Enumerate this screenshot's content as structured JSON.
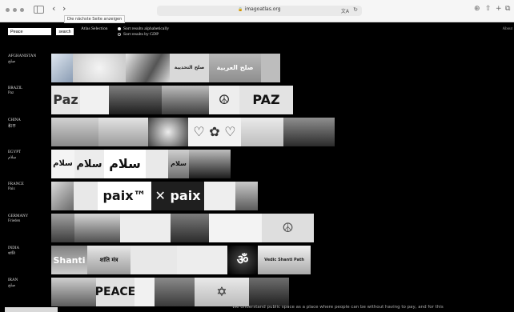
{
  "browser": {
    "url": "imagoatlas.org",
    "tooltip": "Die nächste Seite anzeigen",
    "back": "‹",
    "forward": "›",
    "reload": "↻",
    "translate": "文A",
    "icons": [
      "download-icon",
      "share-icon",
      "new-tab-icon",
      "tabs-icon"
    ]
  },
  "header": {
    "search_value": "Peace",
    "search_button": "search",
    "atlas_selection": "Atlas Selection",
    "sort_alpha": "Sort results alphabetically",
    "sort_gdp": "Sort results by GDP",
    "about": "About"
  },
  "countries": [
    {
      "name": "AFGHANISTAN",
      "native": "صلح",
      "images": [
        {
          "w": 27,
          "bg": "linear-gradient(135deg,#dfe7f0,#8a9cb3)",
          "caption": "",
          "color": "#333"
        },
        {
          "w": 66,
          "bg": "radial-gradient(circle,#f4f4f4,#c9c9c9)",
          "caption": "",
          "color": "#333"
        },
        {
          "w": 55,
          "bg": "linear-gradient(120deg,#e8e8e8,#555 60%,#ddd)",
          "caption": "",
          "color": "#222"
        },
        {
          "w": 49,
          "bg": "#d9d9d9",
          "caption": "صلح التحديية",
          "color": "#222"
        },
        {
          "w": 65,
          "bg": "linear-gradient(#b9b9b9,#8d8d8d)",
          "caption": "صلح العربية",
          "color": "#fff"
        },
        {
          "w": 24,
          "bg": "#bdbdbd",
          "caption": "",
          "color": "#222"
        }
      ]
    },
    {
      "name": "BRAZIL",
      "native": "Paz",
      "images": [
        {
          "w": 36,
          "bg": "#e6e6e6",
          "caption": "Paz",
          "color": "#333"
        },
        {
          "w": 36,
          "bg": "#f1f1f1",
          "caption": "",
          "color": "#222"
        },
        {
          "w": 66,
          "bg": "linear-gradient(#7e7e7e,#1e1e1e)",
          "caption": "",
          "color": "#fff"
        },
        {
          "w": 59,
          "bg": "linear-gradient(#bdbdbd,#3e3e3e)",
          "caption": "",
          "color": "#fff"
        },
        {
          "w": 38,
          "bg": "#ededed",
          "caption": "☮",
          "color": "#222"
        },
        {
          "w": 67,
          "bg": "#e3e3e3",
          "caption": "PAZ",
          "color": "#111"
        }
      ]
    },
    {
      "name": "CHINA",
      "native": "和平",
      "images": [
        {
          "w": 59,
          "bg": "linear-gradient(#d2d2d2,#8a8a8a)",
          "caption": "",
          "color": "#222"
        },
        {
          "w": 62,
          "bg": "linear-gradient(#e3e3e3,#9b9b9b)",
          "caption": "",
          "color": "#222"
        },
        {
          "w": 50,
          "bg": "radial-gradient(circle,#ededed,#404040)",
          "caption": "",
          "color": "#222"
        },
        {
          "w": 66,
          "bg": "#f2f2f2",
          "caption": "♡ ✿ ♡",
          "color": "#333"
        },
        {
          "w": 53,
          "bg": "linear-gradient(#eaeaea,#bdbdbd)",
          "caption": "",
          "color": "#222"
        },
        {
          "w": 64,
          "bg": "linear-gradient(#8f8f8f,#2b2b2b)",
          "caption": "",
          "color": "#fff"
        }
      ]
    },
    {
      "name": "EGYPT",
      "native": "سلام",
      "images": [
        {
          "w": 29,
          "bg": "#f4f4f4",
          "caption": "سلام",
          "color": "#111"
        },
        {
          "w": 37,
          "bg": "#ececec",
          "caption": "سلام",
          "color": "#111"
        },
        {
          "w": 52,
          "bg": "#ffffff",
          "caption": "سلام",
          "color": "#111"
        },
        {
          "w": 28,
          "bg": "#e9e9e9",
          "caption": "",
          "color": "#222"
        },
        {
          "w": 26,
          "bg": "linear-gradient(#cfcfcf,#6f6f6f)",
          "caption": "سلام",
          "color": "#111"
        },
        {
          "w": 52,
          "bg": "linear-gradient(#bdbdbd,#1d1d1d)",
          "caption": "",
          "color": "#fff"
        }
      ]
    },
    {
      "name": "FRANCE",
      "native": "Paix",
      "images": [
        {
          "w": 28,
          "bg": "linear-gradient(135deg,#dcdcdc,#6a6a6a)",
          "caption": "",
          "color": "#222"
        },
        {
          "w": 30,
          "bg": "#e8e8e8",
          "caption": "",
          "color": "#222"
        },
        {
          "w": 67,
          "bg": "#ffffff",
          "caption": "paix™",
          "color": "#111"
        },
        {
          "w": 66,
          "bg": "#1f1f1f",
          "caption": "✕ paix",
          "color": "#fff"
        },
        {
          "w": 39,
          "bg": "#eeeeee",
          "caption": "",
          "color": "#222"
        },
        {
          "w": 28,
          "bg": "linear-gradient(#c9c9c9,#5b5b5b)",
          "caption": "",
          "color": "#222"
        }
      ]
    },
    {
      "name": "GERMANY",
      "native": "Frieden",
      "images": [
        {
          "w": 29,
          "bg": "linear-gradient(#a2a2a2,#3c3c3c)",
          "caption": "",
          "color": "#fff"
        },
        {
          "w": 57,
          "bg": "linear-gradient(#d6d6d6,#4f4f4f)",
          "caption": "",
          "color": "#fff"
        },
        {
          "w": 63,
          "bg": "#ededed",
          "caption": "",
          "color": "#222"
        },
        {
          "w": 48,
          "bg": "linear-gradient(#7b7b7b,#2c2c2c)",
          "caption": "",
          "color": "#fff"
        },
        {
          "w": 66,
          "bg": "#f3f3f3",
          "caption": "",
          "color": "#222"
        },
        {
          "w": 65,
          "bg": "#dedede",
          "caption": "☮",
          "color": "#555"
        }
      ]
    },
    {
      "name": "INDIA",
      "native": "शांति",
      "images": [
        {
          "w": 45,
          "bg": "linear-gradient(#7f7f7f,#cfcfcf)",
          "caption": "Shanti",
          "color": "#fff"
        },
        {
          "w": 54,
          "bg": "linear-gradient(#e7e7e7,#9c9c9c)",
          "caption": "शांति मंत्र",
          "color": "#111"
        },
        {
          "w": 58,
          "bg": "#e8e8e8",
          "caption": "",
          "color": "#222"
        },
        {
          "w": 63,
          "bg": "#ededed",
          "caption": "",
          "color": "#222"
        },
        {
          "w": 38,
          "bg": "radial-gradient(circle,#4a4a4a,#000)",
          "caption": "ॐ",
          "color": "#fff"
        },
        {
          "w": 66,
          "bg": "linear-gradient(#f1f1f1,#a9a9a9)",
          "caption": "Vedic Shanti Path",
          "color": "#222"
        }
      ]
    },
    {
      "name": "IRAN",
      "native": "صلح",
      "images": [
        {
          "w": 56,
          "bg": "linear-gradient(#cfcfcf,#5c5c5c)",
          "caption": "",
          "color": "#222"
        },
        {
          "w": 48,
          "bg": "#e1e1e1",
          "caption": "PEACE",
          "color": "#111"
        },
        {
          "w": 25,
          "bg": "#f1f1f1",
          "caption": "",
          "color": "#222"
        },
        {
          "w": 50,
          "bg": "linear-gradient(#8a8a8a,#3a3a3a)",
          "caption": "",
          "color": "#fff"
        },
        {
          "w": 68,
          "bg": "linear-gradient(#e9e9e9,#bababa)",
          "caption": "✡",
          "color": "#222"
        },
        {
          "w": 50,
          "bg": "linear-gradient(#6e6e6e,#202020)",
          "caption": "",
          "color": "#fff"
        }
      ]
    }
  ],
  "footer": "We understand public space as a place where people can be without having to pay, and for this"
}
